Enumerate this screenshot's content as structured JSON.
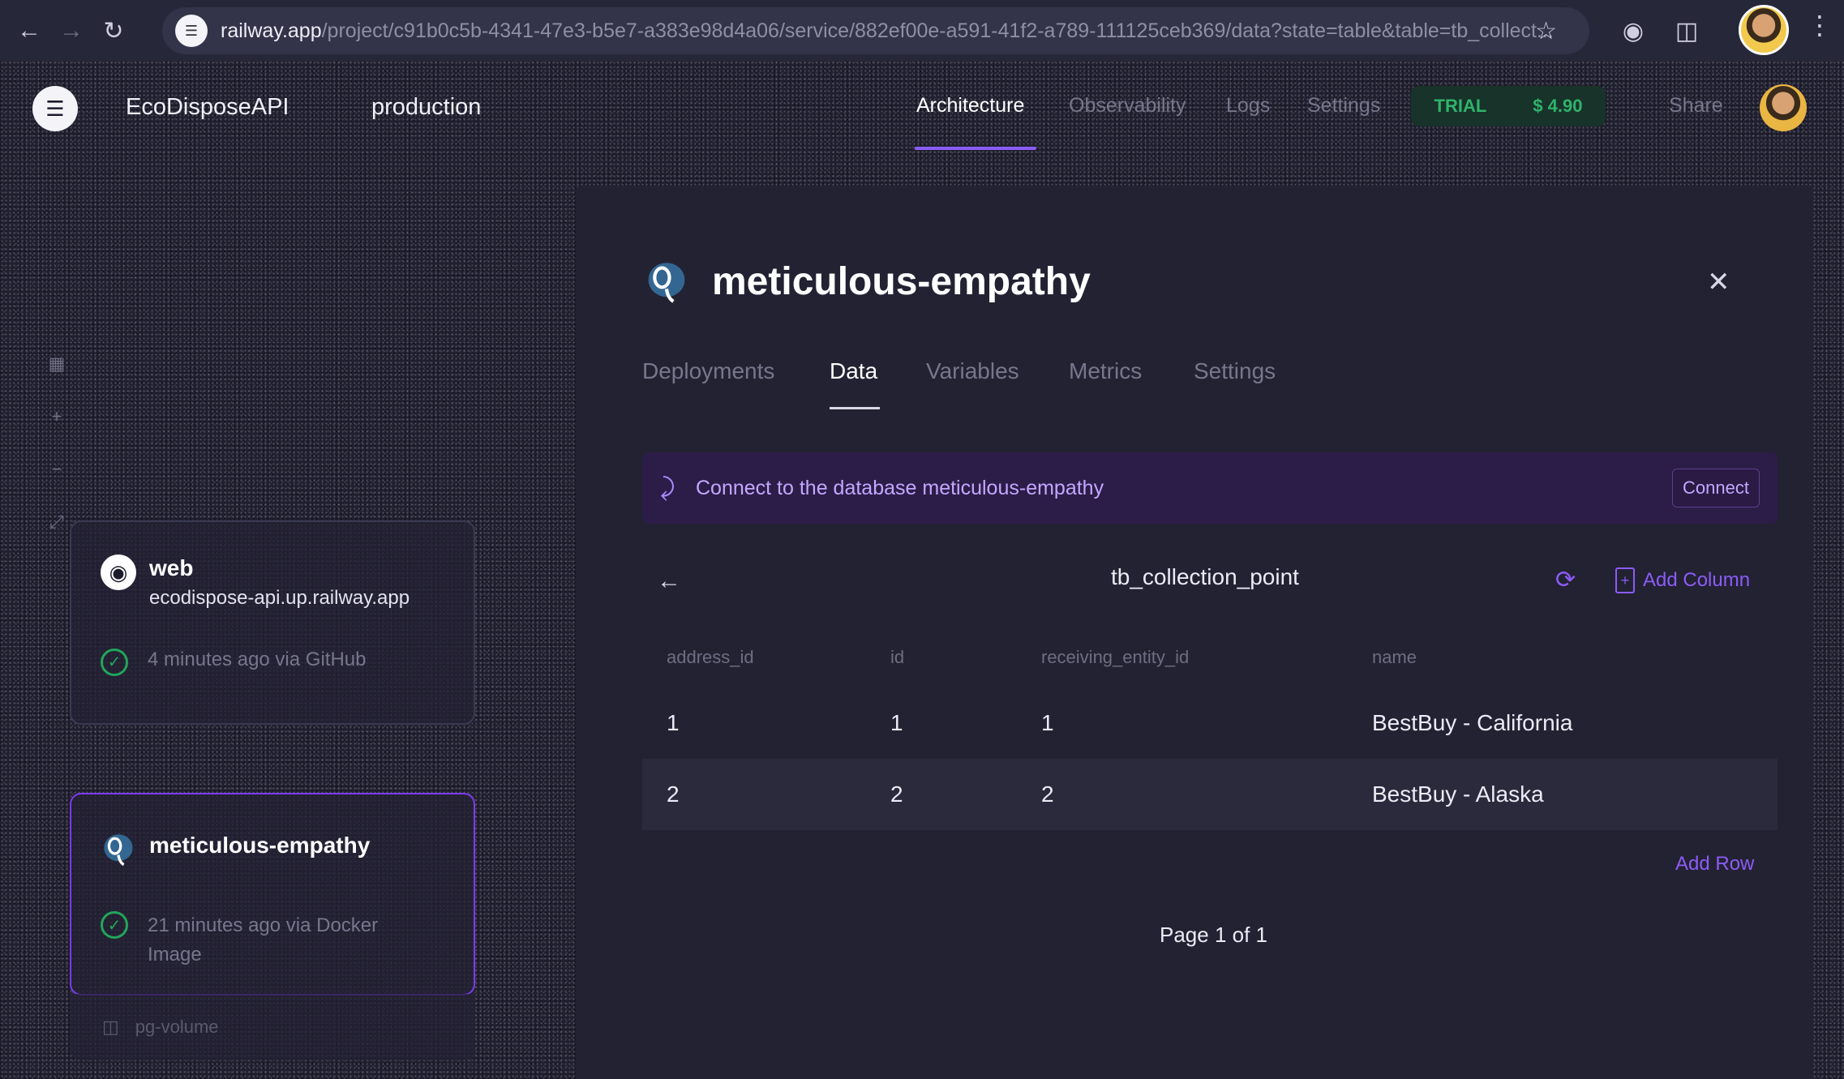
{
  "browser": {
    "url_host": "railway.app",
    "url_path": "/project/c91b0c5b-4341-47e3-b5e7-a383e98d4a06/service/882ef00e-a591-41f2-a789-111125ceb369/data?state=table&table=tb_collect..."
  },
  "header": {
    "project_name": "EcoDisposeAPI",
    "environment": "production",
    "tabs": [
      {
        "label": "Architecture"
      },
      {
        "label": "Observability"
      },
      {
        "label": "Logs"
      },
      {
        "label": "Settings"
      }
    ],
    "trial_label": "TRIAL",
    "trial_amount": "$ 4.90",
    "share_label": "Share"
  },
  "canvas": {
    "services": [
      {
        "name": "web",
        "url": "ecodispose-api.up.railway.app",
        "status": "4 minutes ago via GitHub"
      },
      {
        "name": "meticulous-empathy",
        "status": "21 minutes ago via Docker Image"
      }
    ],
    "volume_label": "pg-volume"
  },
  "panel": {
    "title": "meticulous-empathy",
    "tabs": [
      {
        "label": "Deployments"
      },
      {
        "label": "Data"
      },
      {
        "label": "Variables"
      },
      {
        "label": "Metrics"
      },
      {
        "label": "Settings"
      }
    ],
    "banner_text": "Connect to the database meticulous-empathy",
    "connect_label": "Connect",
    "table_name": "tb_collection_point",
    "add_column_label": "Add Column",
    "columns": [
      "address_id",
      "id",
      "receiving_entity_id",
      "name"
    ],
    "rows": [
      [
        "1",
        "1",
        "1",
        "BestBuy - California"
      ],
      [
        "2",
        "2",
        "2",
        "BestBuy - Alaska"
      ]
    ],
    "add_row_label": "Add Row",
    "page_info": "Page 1 of 1"
  },
  "colors": {
    "accent": "#8b5cf6",
    "success": "#22a55a",
    "background": "#1c1b2b"
  }
}
